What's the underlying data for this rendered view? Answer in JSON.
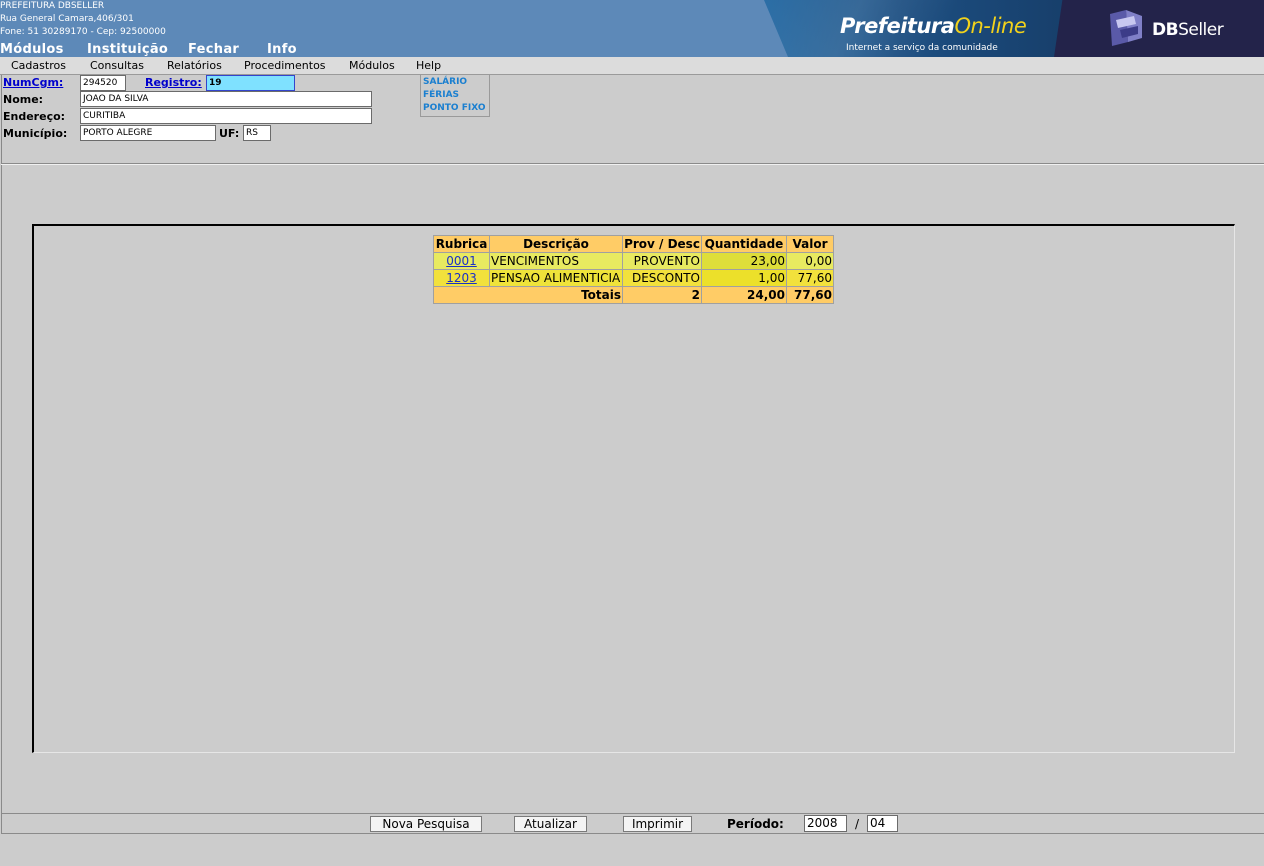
{
  "header": {
    "inst_name": "PREFEITURA DBSELLER",
    "address": "Rua General Camara,406/301",
    "phone_line": "Fone: 51 30289170  -  Cep: 92500000",
    "top_menu": [
      "Módulos",
      "Instituição",
      "Fechar",
      "Info"
    ],
    "banner": {
      "brand_part1": "Prefeitura",
      "brand_part2": "On-line",
      "tagline": "Internet a serviço da comunidade",
      "vendor_bold": "DB",
      "vendor_rest": "Seller"
    }
  },
  "menubar": [
    "Cadastros",
    "Consultas",
    "Relatórios",
    "Procedimentos",
    "Módulos",
    "Help"
  ],
  "form": {
    "numcgm_label": "NumCgm:",
    "numcgm_value": "294520",
    "registro_label": "Registro:",
    "registro_value": "19",
    "nome_label": "Nome:",
    "nome_value": "JOAO DA SILVA",
    "endereco_label": "Endereço:",
    "endereco_value": "CURITIBA",
    "municipio_label": "Município:",
    "municipio_value": "PORTO ALEGRE",
    "uf_label": "UF:",
    "uf_value": "RS"
  },
  "tipo_folha": [
    "SALÁRIO",
    "FÉRIAS",
    "PONTO FIXO"
  ],
  "table": {
    "headers": [
      "Rubrica",
      "Descrição",
      "Prov / Desc",
      "Quantidade",
      "Valor"
    ],
    "rows": [
      {
        "rubrica": "0001",
        "descricao": "VENCIMENTOS",
        "tipo": "PROVENTO",
        "quantidade": "23,00",
        "valor": "0,00"
      },
      {
        "rubrica": "1203",
        "descricao": "PENSAO ALIMENTICIA",
        "tipo": "DESCONTO",
        "quantidade": "1,00",
        "valor": "77,60"
      }
    ],
    "totals": {
      "label": "Totais",
      "count": "2",
      "quantidade": "24,00",
      "valor": "77,60"
    }
  },
  "bottom": {
    "nova_pesquisa": "Nova Pesquisa",
    "atualizar": "Atualizar",
    "imprimir": "Imprimir",
    "periodo_label": "Período:",
    "ano": "2008",
    "mes": "04"
  }
}
